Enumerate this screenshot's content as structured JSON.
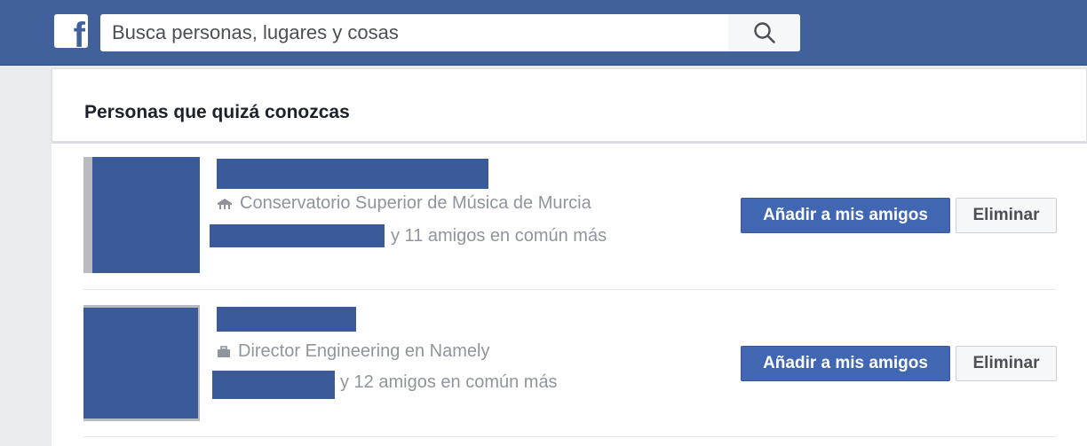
{
  "header": {
    "search_placeholder": "Busca personas, lugares y cosas"
  },
  "panel": {
    "title": "Personas que quizá conozcas"
  },
  "suggestions": [
    {
      "detail_icon": "school-icon",
      "detail": "Conservatorio Superior de Música de Murcia",
      "mutual": "y 11 amigos en común más",
      "add_label": "Añadir a mis amigos",
      "remove_label": "Eliminar"
    },
    {
      "detail_icon": "briefcase-icon",
      "detail": "Director Engineering en Namely",
      "mutual": "y 12 amigos en común más",
      "add_label": "Añadir a mis amigos",
      "remove_label": "Eliminar"
    }
  ],
  "colors": {
    "brand_blue": "#42619c",
    "redaction": "#3b5a9a",
    "button_primary": "#4267b2"
  }
}
